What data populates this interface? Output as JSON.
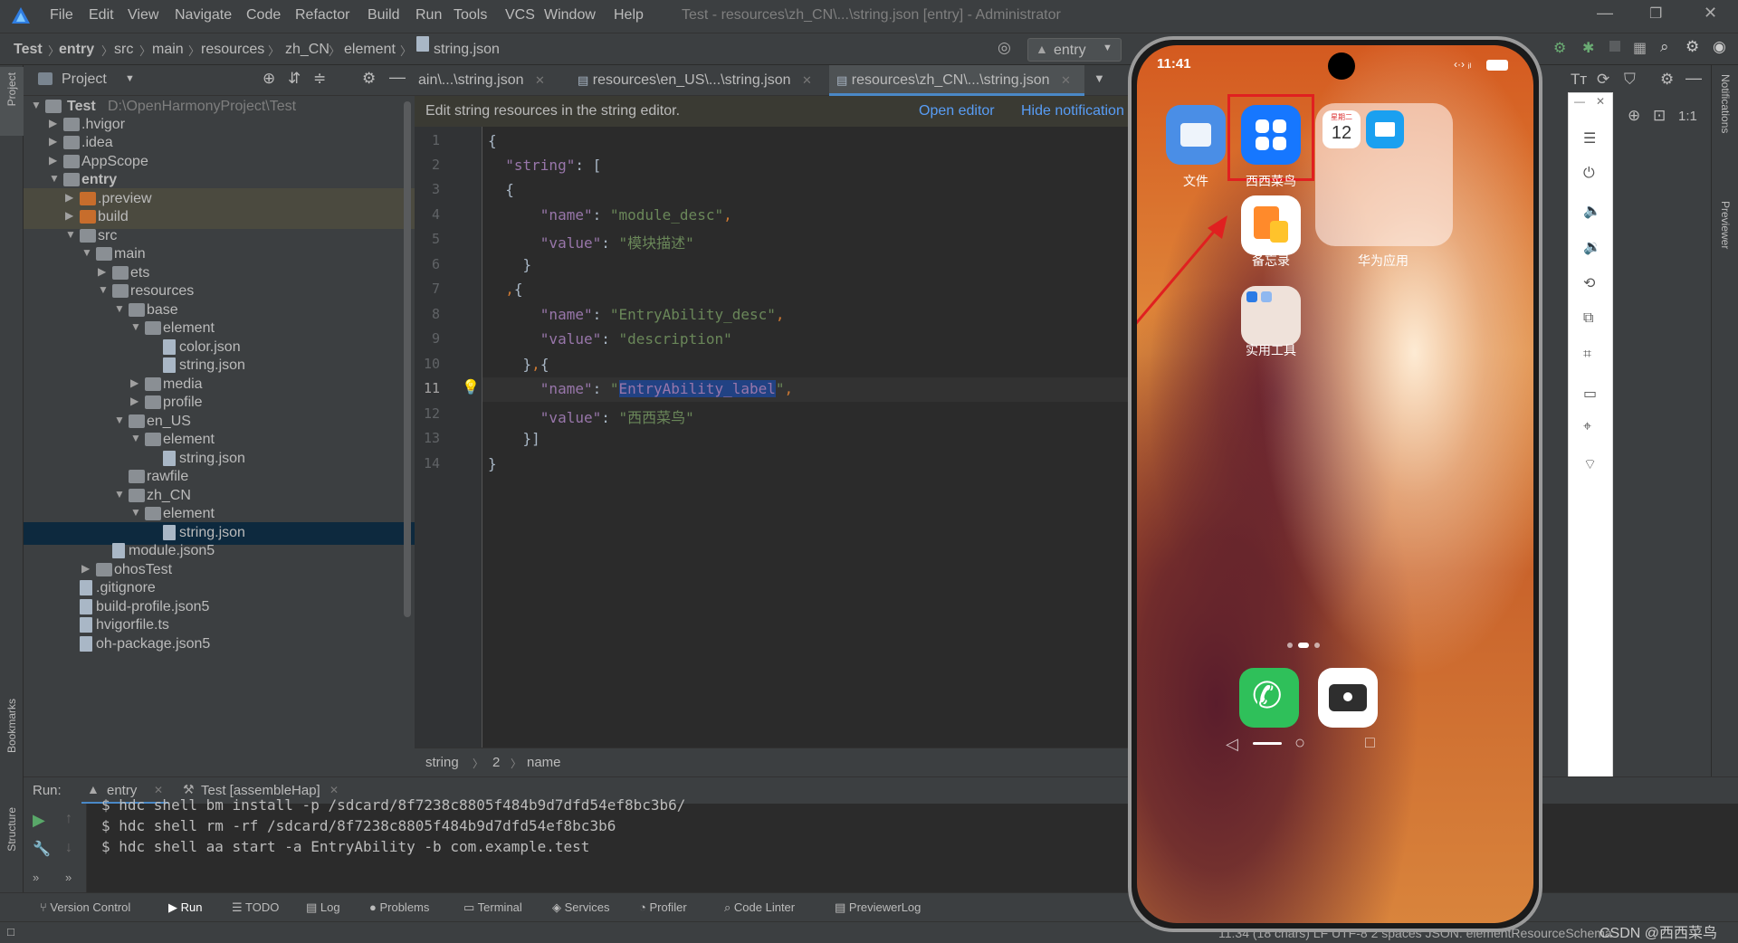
{
  "window": {
    "title": "Test - resources\\zh_CN\\...\\string.json [entry] - Administrator",
    "menu": [
      "File",
      "Edit",
      "View",
      "Navigate",
      "Code",
      "Refactor",
      "Build",
      "Run",
      "Tools",
      "VCS",
      "Window",
      "Help"
    ]
  },
  "breadcrumb": [
    "Test",
    "entry",
    "src",
    "main",
    "resources",
    "zh_CN",
    "element",
    "string.json"
  ],
  "run_config": "entry",
  "project_panel": {
    "title": "Project",
    "root": "Test",
    "root_path": "D:\\OpenHarmonyProject\\Test",
    "tree": [
      ".hvigor",
      ".idea",
      "AppScope",
      "entry",
      ".preview",
      "build",
      "src",
      "main",
      "ets",
      "resources",
      "base",
      "element",
      "color.json",
      "string.json",
      "media",
      "profile",
      "en_US",
      "element",
      "string.json",
      "rawfile",
      "zh_CN",
      "element",
      "string.json",
      "module.json5",
      "ohosTest",
      ".gitignore",
      "build-profile.json5",
      "hvigorfile.ts",
      "oh-package.json5"
    ]
  },
  "editor": {
    "tabs": [
      "ain\\...\\string.json",
      "resources\\en_US\\...\\string.json",
      "resources\\zh_CN\\...\\string.json"
    ],
    "notification": "Edit string resources in the string editor.",
    "open_editor": "Open editor",
    "hide_notification": "Hide notification",
    "line_numbers": [
      "1",
      "2",
      "3",
      "4",
      "5",
      "6",
      "7",
      "8",
      "9",
      "10",
      "11",
      "12",
      "13",
      "14"
    ],
    "code": {
      "l1": "{",
      "l2_key": "\"string\"",
      "l2_rest": ": [",
      "l3": "  {",
      "l4_key": "\"name\"",
      "l4_val": "\"module_desc\"",
      "l5_key": "\"value\"",
      "l5_val": "\"模块描述\"",
      "l6": "  }",
      "l7": ",{",
      "l8_key": "\"name\"",
      "l8_val": "\"EntryAbility_desc\"",
      "l9_key": "\"value\"",
      "l9_val": "\"description\"",
      "l10": "},{",
      "l11_key": "\"name\"",
      "l11_val_q": "\"",
      "l11_val_sel": "EntryAbility_label",
      "l11_val_end": "\"",
      "l12_key": "\"value\"",
      "l12_val": "\"西西菜鸟\"",
      "l13": "}]",
      "l14": "}"
    },
    "status": [
      "string",
      "2",
      "name"
    ]
  },
  "run_panel": {
    "label": "Run:",
    "tabs": [
      "entry",
      "Test [assembleHap]"
    ],
    "lines": [
      "$ hdc shell bm install -p /sdcard/8f7238c8805f484b9d7dfd54ef8bc3b6/",
      "$ hdc shell rm -rf /sdcard/8f7238c8805f484b9d7dfd54ef8bc3b6",
      "$ hdc shell aa start -a EntryAbility -b com.example.test"
    ]
  },
  "bottom_tools": [
    "Version Control",
    "Run",
    "TODO",
    "Log",
    "Problems",
    "Terminal",
    "Services",
    "Profiler",
    "Code Linter",
    "PreviewerLog"
  ],
  "status_bar": {
    "text": "11:34 (18 chars)   LF   UTF-8   2 spaces   JSON: elementResourceSchema",
    "watermark": "CSDN @西西菜鸟"
  },
  "side_labels": [
    "Project",
    "Bookmarks",
    "Structure",
    "Notifications",
    "Previewer"
  ],
  "phone": {
    "time": "11:41",
    "apps": [
      {
        "label": "文件",
        "color": "#4a90e2"
      },
      {
        "label": "西西菜鸟",
        "color": "#1677ff"
      },
      {
        "label": "备忘录",
        "color": "#ff9a2e"
      },
      {
        "label": "实用工具",
        "color": "#e9d9d0"
      }
    ],
    "folder_label": "华为应用",
    "calendar_day": "12",
    "calendar_header": "星期二",
    "highlight_color": "#e02020"
  }
}
